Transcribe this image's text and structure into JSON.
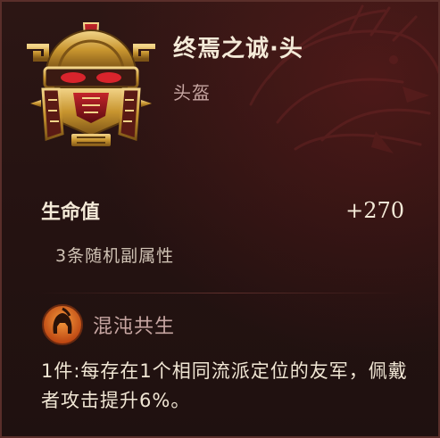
{
  "item": {
    "name": "终焉之诚·头",
    "type": "头盔"
  },
  "stat": {
    "label": "生命值",
    "value": "+270"
  },
  "substats": "3条随机副属性",
  "set": {
    "name": "混沌共生",
    "icon": "spartan-helmet-icon",
    "description": "1件:每存在1个相同流派定位的友军，佩戴者攻击提升6%。"
  },
  "colors": {
    "background": "#241211",
    "title": "#f4ead8",
    "muted": "#c7a6a2",
    "set_icon": "#e0641f"
  }
}
